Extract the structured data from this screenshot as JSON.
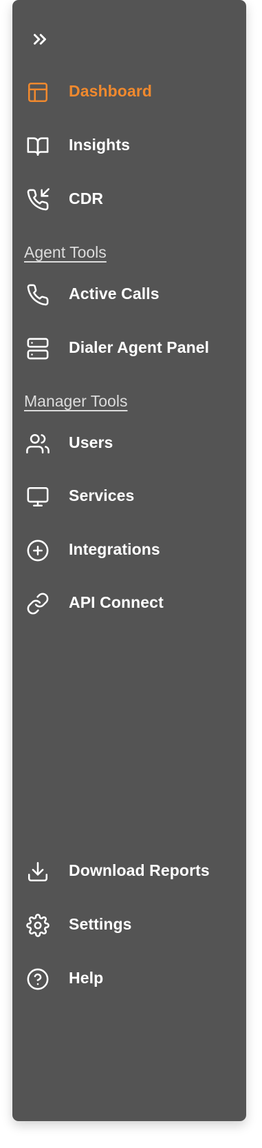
{
  "colors": {
    "sidebar_bg": "#545454",
    "accent": "#f0892e",
    "text": "#ffffff",
    "section_heading": "#dcdcdc"
  },
  "toggle": {
    "icon": "chevrons-right-icon"
  },
  "nav": {
    "primary": [
      {
        "label": "Dashboard",
        "icon": "layout-icon",
        "active": true
      },
      {
        "label": "Insights",
        "icon": "book-open-icon",
        "active": false
      },
      {
        "label": "CDR",
        "icon": "phone-incoming-icon",
        "active": false
      }
    ],
    "agent_tools": {
      "heading": "Agent Tools",
      "items": [
        {
          "label": "Active Calls",
          "icon": "phone-icon"
        },
        {
          "label": "Dialer Agent Panel",
          "icon": "server-icon"
        }
      ]
    },
    "manager_tools": {
      "heading": "Manager Tools",
      "items": [
        {
          "label": "Users",
          "icon": "users-icon"
        },
        {
          "label": "Services",
          "icon": "monitor-icon"
        },
        {
          "label": "Integrations",
          "icon": "plus-circle-icon"
        },
        {
          "label": "API Connect",
          "icon": "link-icon"
        }
      ]
    },
    "bottom": [
      {
        "label": "Download Reports",
        "icon": "download-icon"
      },
      {
        "label": "Settings",
        "icon": "settings-icon"
      },
      {
        "label": "Help",
        "icon": "help-circle-icon"
      }
    ]
  }
}
